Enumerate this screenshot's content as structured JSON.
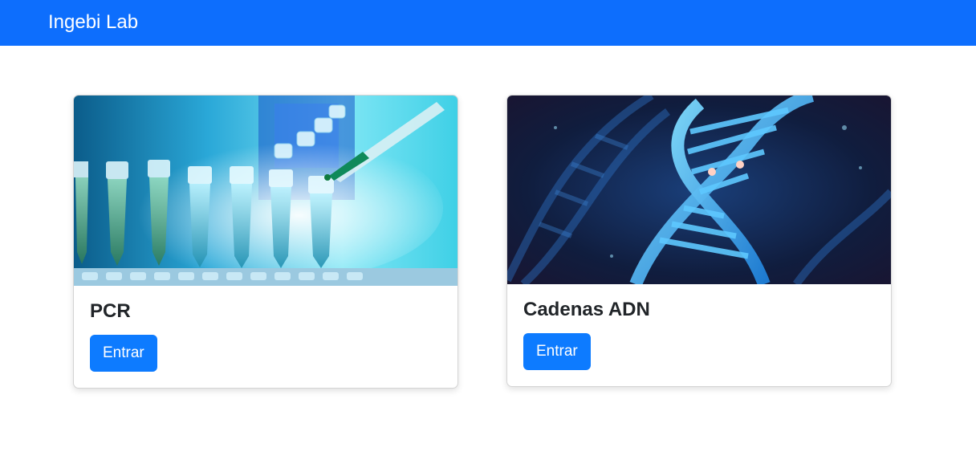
{
  "navbar": {
    "brand": "Ingebi Lab",
    "color": "#0d6efd"
  },
  "cards": [
    {
      "title": "PCR",
      "button_label": "Entrar",
      "image": "pcr-tubes-pipette-photo"
    },
    {
      "title": "Cadenas ADN",
      "button_label": "Entrar",
      "image": "dna-double-helix-photo"
    }
  ],
  "colors": {
    "button": "#0d7bff",
    "title_text": "#212529"
  }
}
